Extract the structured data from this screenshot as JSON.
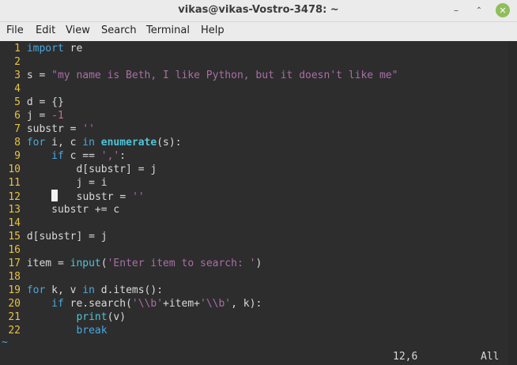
{
  "window": {
    "title": "vikas@vikas-Vostro-3478: ~",
    "buttons": {
      "minimize": "–",
      "maximize": "⌃",
      "close": "✕"
    }
  },
  "menu": [
    "File",
    "Edit",
    "View",
    "Search",
    "Terminal",
    "Help"
  ],
  "editor": {
    "lines": [
      {
        "n": "1",
        "segs": [
          [
            "kw",
            "import"
          ],
          [
            "code",
            " re"
          ]
        ]
      },
      {
        "n": "2",
        "segs": []
      },
      {
        "n": "3",
        "segs": [
          [
            "code",
            "s = "
          ],
          [
            "str",
            "\"my name is Beth, I like Python, but it doesn't like me\""
          ]
        ]
      },
      {
        "n": "4",
        "segs": []
      },
      {
        "n": "5",
        "segs": [
          [
            "code",
            "d = {}"
          ]
        ]
      },
      {
        "n": "6",
        "segs": [
          [
            "code",
            "j = "
          ],
          [
            "num",
            "-1"
          ]
        ]
      },
      {
        "n": "7",
        "segs": [
          [
            "code",
            "substr = "
          ],
          [
            "str",
            "''"
          ]
        ]
      },
      {
        "n": "8",
        "segs": [
          [
            "kw",
            "for"
          ],
          [
            "code",
            " i, c "
          ],
          [
            "kw",
            "in"
          ],
          [
            "code",
            " "
          ],
          [
            "kwb",
            "enumerate"
          ],
          [
            "code",
            "(s):"
          ]
        ]
      },
      {
        "n": "9",
        "segs": [
          [
            "code",
            "    "
          ],
          [
            "kw",
            "if"
          ],
          [
            "code",
            " c == "
          ],
          [
            "str",
            "','"
          ],
          [
            "code",
            ":"
          ]
        ]
      },
      {
        "n": "10",
        "segs": [
          [
            "code",
            "        d[substr] = j"
          ]
        ]
      },
      {
        "n": "11",
        "segs": [
          [
            "code",
            "        j = i"
          ]
        ]
      },
      {
        "n": "12",
        "segs": [
          [
            "code",
            "    "
          ],
          [
            "cursor",
            ""
          ],
          [
            "code",
            "   substr = "
          ],
          [
            "str",
            "''"
          ]
        ]
      },
      {
        "n": "13",
        "segs": [
          [
            "code",
            "    substr += c"
          ]
        ]
      },
      {
        "n": "14",
        "segs": []
      },
      {
        "n": "15",
        "segs": [
          [
            "code",
            "d[substr] = j"
          ]
        ]
      },
      {
        "n": "16",
        "segs": []
      },
      {
        "n": "17",
        "segs": [
          [
            "code",
            "item = "
          ],
          [
            "fn",
            "input"
          ],
          [
            "code",
            "("
          ],
          [
            "str",
            "'Enter item to search: '"
          ],
          [
            "code",
            ")"
          ]
        ]
      },
      {
        "n": "18",
        "segs": []
      },
      {
        "n": "19",
        "segs": [
          [
            "kw",
            "for"
          ],
          [
            "code",
            " k, v "
          ],
          [
            "kw",
            "in"
          ],
          [
            "code",
            " d.items():"
          ]
        ]
      },
      {
        "n": "20",
        "segs": [
          [
            "code",
            "    "
          ],
          [
            "kw",
            "if"
          ],
          [
            "code",
            " re.search("
          ],
          [
            "str",
            "'\\\\b'"
          ],
          [
            "code",
            "+item+"
          ],
          [
            "str",
            "'\\\\b'"
          ],
          [
            "code",
            ", k):"
          ]
        ]
      },
      {
        "n": "21",
        "segs": [
          [
            "code",
            "        "
          ],
          [
            "fn",
            "print"
          ],
          [
            "code",
            "(v)"
          ]
        ]
      },
      {
        "n": "22",
        "segs": [
          [
            "code",
            "        "
          ],
          [
            "kw",
            "break"
          ]
        ]
      }
    ],
    "tilde": "~"
  },
  "status": {
    "position": "12,6",
    "scroll": "All"
  }
}
